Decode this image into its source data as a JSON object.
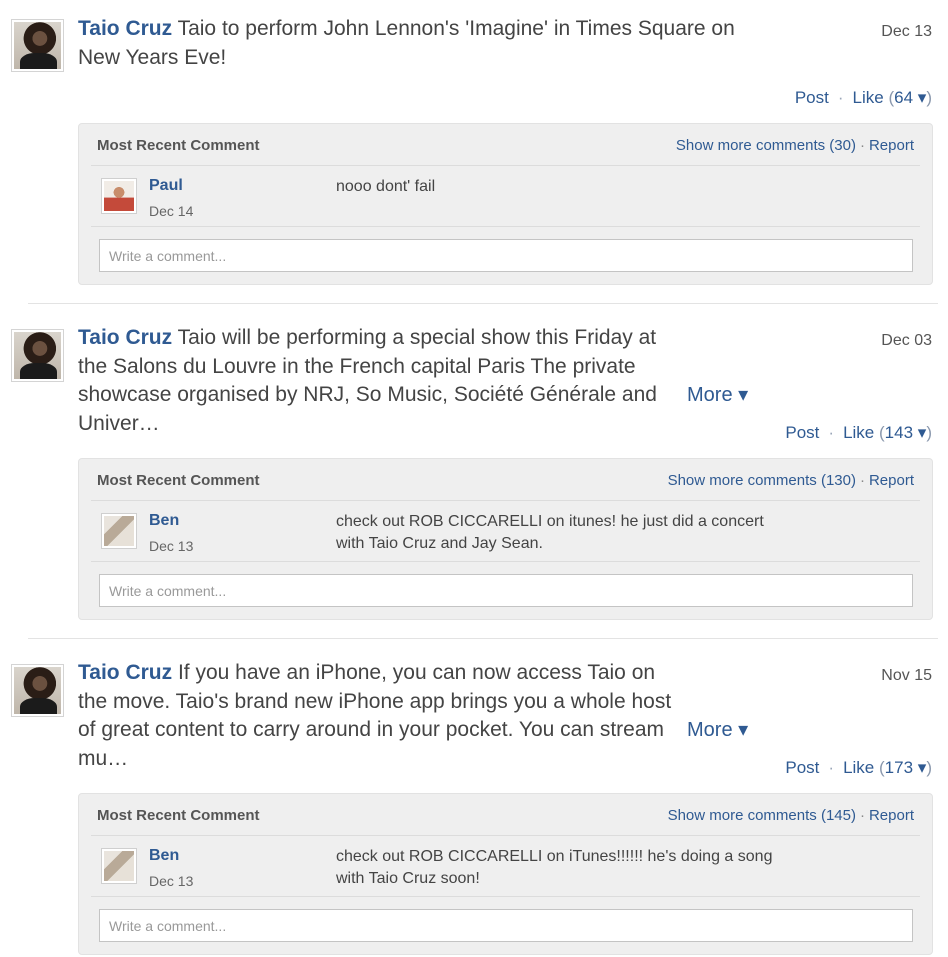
{
  "posts": [
    {
      "author": "Taio Cruz",
      "text": " Taio to perform John Lennon's 'Imagine' in Times Square on New Years Eve!",
      "date": "Dec 13",
      "more": "",
      "actions": {
        "post": "Post",
        "like": "Like",
        "count": "64",
        "caret": "▾"
      },
      "comments": {
        "header": "Most Recent Comment",
        "show_more": "Show more comments (30)",
        "report": "Report",
        "comment": {
          "name": "Paul",
          "date": "Dec 14",
          "text": "nooo dont' fail"
        },
        "placeholder": "Write a comment..."
      }
    },
    {
      "author": "Taio Cruz",
      "text": " Taio will be performing a special show this Friday at the Salons du Louvre in the French capital Paris The private showcase organised by NRJ, So Music, Société Générale and Univer…",
      "date": "Dec 03",
      "more": "More ▾",
      "actions": {
        "post": "Post",
        "like": "Like",
        "count": "143",
        "caret": "▾"
      },
      "comments": {
        "header": "Most Recent Comment",
        "show_more": "Show more comments (130)",
        "report": "Report",
        "comment": {
          "name": "Ben",
          "date": "Dec 13",
          "text": "check out ROB CICCARELLI on itunes! he just did a concert with Taio Cruz and Jay Sean."
        },
        "placeholder": "Write a comment..."
      }
    },
    {
      "author": "Taio Cruz",
      "text": " If you have an iPhone, you can now access Taio on the move. Taio's brand new iPhone app brings you a whole host of great content to carry around in your pocket. You can stream mu…",
      "date": "Nov 15",
      "more": "More ▾",
      "actions": {
        "post": "Post",
        "like": "Like",
        "count": "173",
        "caret": "▾"
      },
      "comments": {
        "header": "Most Recent Comment",
        "show_more": "Show more comments (145)",
        "report": "Report",
        "comment": {
          "name": "Ben",
          "date": "Dec 13",
          "text": "check out ROB CICCARELLI on iTunes!!!!!! he's doing a song with Taio Cruz soon!"
        },
        "placeholder": "Write a comment..."
      }
    }
  ]
}
